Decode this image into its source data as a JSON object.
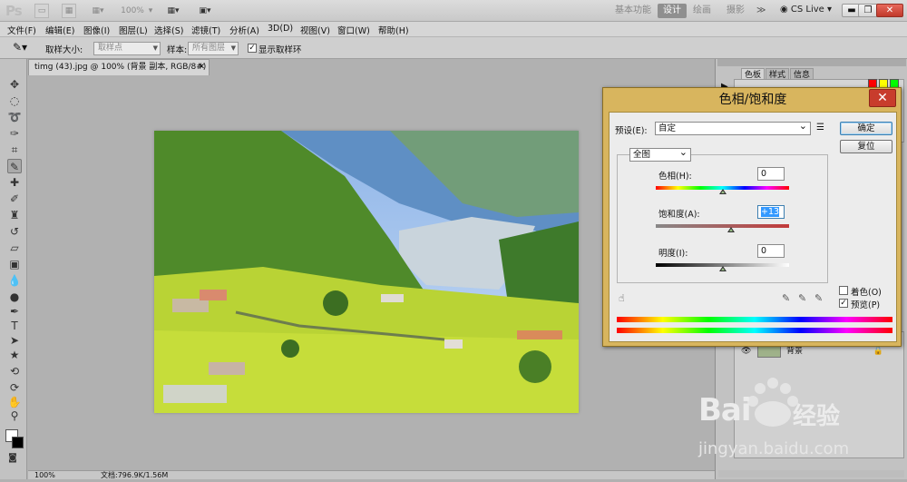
{
  "app": {
    "logo": "Ps"
  },
  "topbar": {
    "zoom": "100%",
    "workspaces": [
      "基本功能",
      "设计",
      "绘画",
      "摄影"
    ],
    "active_workspace": "设计",
    "more": "≫",
    "cslive": "CS Live"
  },
  "menubar": {
    "items": [
      "文件(F)",
      "编辑(E)",
      "图像(I)",
      "图层(L)",
      "选择(S)",
      "滤镜(T)",
      "分析(A)",
      "3D(D)",
      "视图(V)",
      "窗口(W)",
      "帮助(H)"
    ]
  },
  "options": {
    "sample_size_label": "取样大小:",
    "sample_size_value": "取样点",
    "sample_label": "样本:",
    "sample_value": "所有图层",
    "show_ring_label": "显示取样环"
  },
  "document": {
    "tab_title": "timg (43).jpg @ 100% (背景 副本, RGB/8#) *",
    "zoom": "100%",
    "doc_size": "文档:796.9K/1.56M"
  },
  "panels": {
    "tabs": [
      "色板",
      "样式",
      "信息"
    ],
    "layer_name": "背景",
    "swatch_colors": [
      "#ff0000",
      "#ffff00",
      "#00ff00",
      "#00ffff",
      "#0000ff",
      "#ff00ff",
      "#ffffff",
      "#ff0000",
      "#00ff00",
      "#0000ff"
    ]
  },
  "dialog": {
    "title": "色相/饱和度",
    "preset_label": "预设(E):",
    "preset_value": "自定",
    "ok": "确定",
    "reset": "复位",
    "channel": "全图",
    "hue_label": "色相(H):",
    "hue_value": "0",
    "saturation_label": "饱和度(A):",
    "saturation_value": "+13",
    "lightness_label": "明度(I):",
    "lightness_value": "0",
    "colorize_label": "着色(O)",
    "preview_label": "预览(P)",
    "hue": 0,
    "saturation": 13,
    "lightness": 0
  },
  "watermark": {
    "brand": "Bai",
    "brand_cn": "经验",
    "url": "jingyan.baidu.com"
  }
}
